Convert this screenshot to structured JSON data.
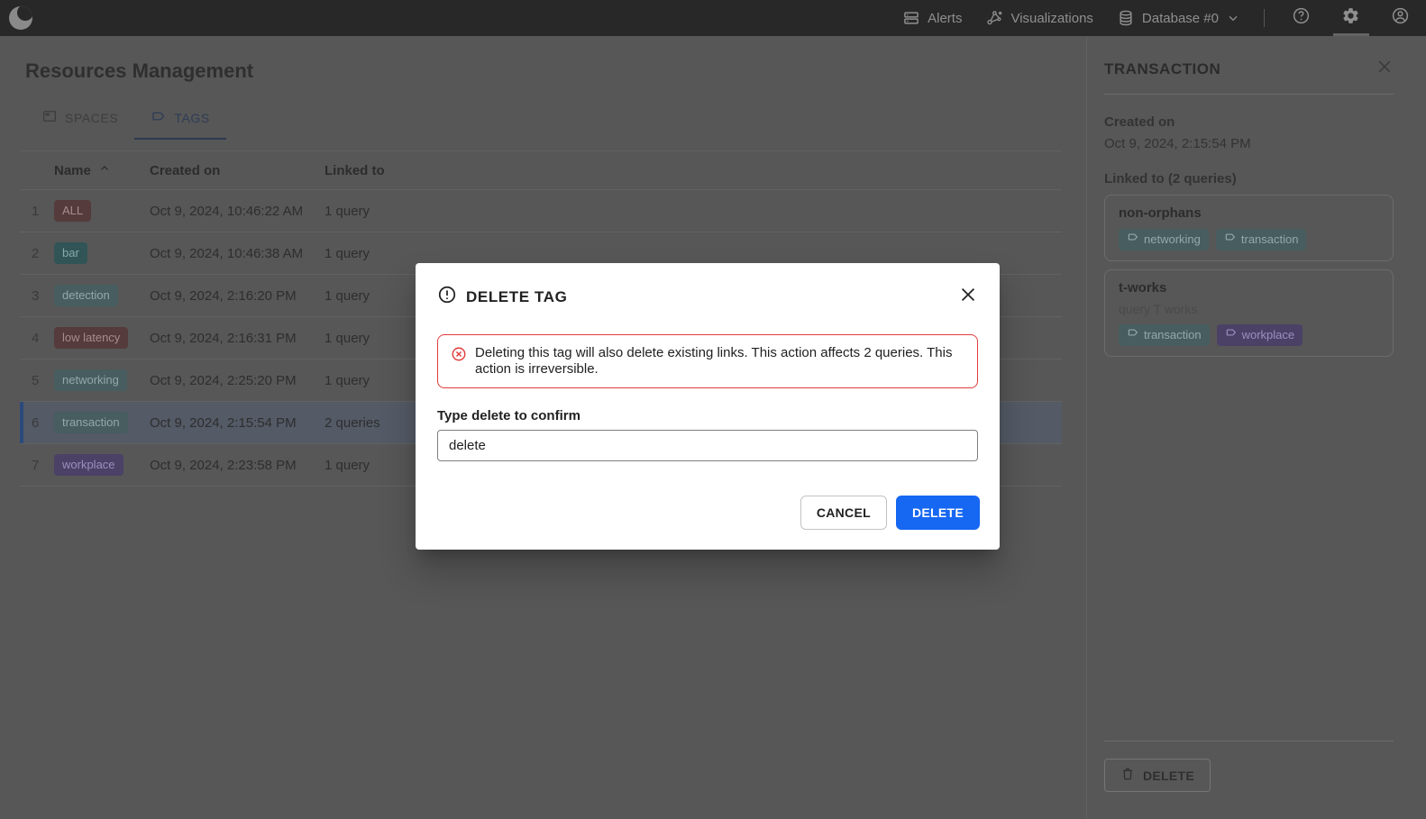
{
  "navbar": {
    "alerts_label": "Alerts",
    "visualizations_label": "Visualizations",
    "database_label": "Database #0"
  },
  "page": {
    "title": "Resources Management"
  },
  "tabs": {
    "spaces": "SPACES",
    "tags": "TAGS",
    "active": "TAGS"
  },
  "table": {
    "columns": {
      "name": "Name",
      "created": "Created on",
      "linked": "Linked to"
    },
    "rows": [
      {
        "index": "1",
        "tag": "ALL",
        "color": "maroon",
        "created": "Oct 9, 2024, 10:46:22 AM",
        "linked": "1 query"
      },
      {
        "index": "2",
        "tag": "bar",
        "color": "teal",
        "created": "Oct 9, 2024, 10:46:38 AM",
        "linked": "1 query"
      },
      {
        "index": "3",
        "tag": "detection",
        "color": "sage",
        "created": "Oct 9, 2024, 2:16:20 PM",
        "linked": "1 query"
      },
      {
        "index": "4",
        "tag": "low latency",
        "color": "maroon",
        "created": "Oct 9, 2024, 2:16:31 PM",
        "linked": "1 query"
      },
      {
        "index": "5",
        "tag": "networking",
        "color": "sage",
        "created": "Oct 9, 2024, 2:25:20 PM",
        "linked": "1 query"
      },
      {
        "index": "6",
        "tag": "transaction",
        "color": "sage",
        "created": "Oct 9, 2024, 2:15:54 PM",
        "linked": "2 queries",
        "selected": true
      },
      {
        "index": "7",
        "tag": "workplace",
        "color": "purple",
        "created": "Oct 9, 2024, 2:23:58 PM",
        "linked": "1 query"
      }
    ]
  },
  "panel": {
    "title": "TRANSACTION",
    "created_label": "Created on",
    "created_value": "Oct 9, 2024, 2:15:54 PM",
    "linked_label": "Linked to (2 queries)",
    "queries": [
      {
        "name": "non-orphans",
        "description": "",
        "tags": [
          "networking",
          "transaction"
        ]
      },
      {
        "name": "t-works",
        "description": "query T works",
        "tags": [
          "transaction",
          "workplace"
        ]
      }
    ],
    "delete_label": "DELETE"
  },
  "modal": {
    "title": "DELETE TAG",
    "warning": "Deleting this tag will also delete existing links. This action affects 2 queries. This action is irreversible.",
    "confirm_label": "Type delete to confirm",
    "input_value": "delete",
    "cancel_label": "CANCEL",
    "delete_label": "DELETE"
  },
  "icons": {
    "logo": "crescent-logo",
    "alerts": "rows-icon",
    "visualizations": "graph-nodes-icon",
    "database": "database-cylinder-icon",
    "chevron": "chevron-down-icon",
    "help": "question-circle-icon",
    "settings": "gear-icon",
    "profile": "person-circle-icon",
    "spaces_tab": "window-icon",
    "tags_tab": "tag-icon",
    "sort": "chevron-up-icon",
    "modal_title": "exclamation-circle-icon",
    "warning": "error-circle-icon",
    "close": "close-x-icon",
    "trash": "trash-icon"
  },
  "colors": {
    "accent_blue": "#1667f2",
    "warning_red": "#e23b3b",
    "selected_row_bar": "#2b4a7c",
    "tag_maroon_bg": "#553b3b",
    "tag_teal_bg": "#315457",
    "tag_sage_bg": "#475d5f",
    "tag_purple_bg": "#4b4066",
    "navbar_bg": "#282828",
    "dimmed_bg": "#575757"
  }
}
